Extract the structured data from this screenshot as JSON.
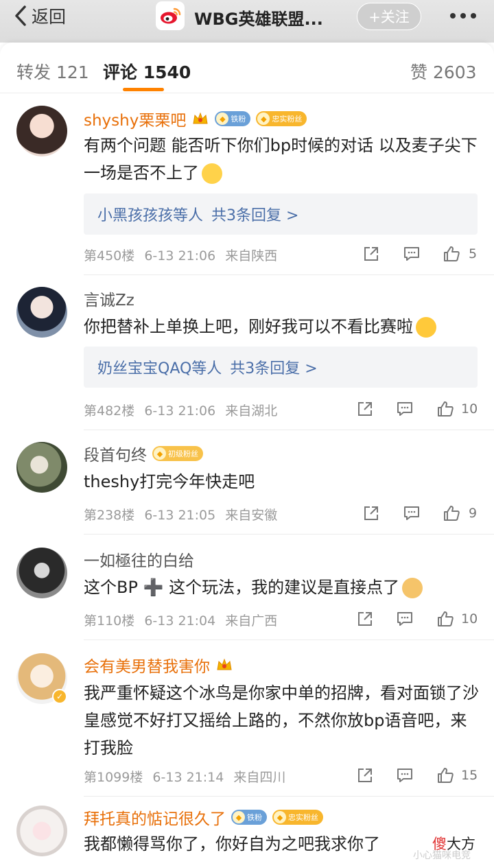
{
  "topbar": {
    "back_label": "返回",
    "title": "WBG英雄联盟...",
    "follow_label": "+关注"
  },
  "tabs": {
    "repost": "转发 121",
    "comments": "评论 1540",
    "likes": "赞 2603"
  },
  "comments": [
    {
      "user": "shyshy栗栗吧",
      "badges": [
        "铁粉",
        "忠实粉丝"
      ],
      "text": "有两个问题 能否听下你们bp时候的对话 以及麦子尖下一场是否不上了",
      "reply_users": "小黑孩孩孩等人",
      "reply_count": "共3条回复 >",
      "floor": "第450楼",
      "time": "6-13 21:06",
      "location": "来自陕西",
      "likes": "5"
    },
    {
      "user": "言诚Zz",
      "badges": [],
      "text": "你把替补上单换上吧，刚好我可以不看比赛啦",
      "reply_users": "奶丝宝宝QAQ等人",
      "reply_count": "共3条回复 >",
      "floor": "第482楼",
      "time": "6-13 21:06",
      "location": "来自湖北",
      "likes": "10"
    },
    {
      "user": "段首句终",
      "badges": [
        "初级粉丝"
      ],
      "text": "theshy打完今年快走吧",
      "floor": "第238楼",
      "time": "6-13 21:05",
      "location": "来自安徽",
      "likes": "9"
    },
    {
      "user": "一如極往的白给",
      "badges": [],
      "text": "这个BP ➕ 这个玩法，我的建议是直接点了",
      "floor": "第110楼",
      "time": "6-13 21:04",
      "location": "来自广西",
      "likes": "10"
    },
    {
      "user": "会有美男替我害你",
      "badges": [],
      "text": "我严重怀疑这个冰鸟是你家中单的招牌，看对面锁了沙皇感觉不好打又摇给上路的，不然你放bp语音吧，来打我脸",
      "floor": "第1099楼",
      "time": "6-13 21:14",
      "location": "来自四川",
      "likes": "15"
    },
    {
      "user": "拜托真的惦记很久了",
      "badges": [
        "铁粉",
        "忠实粉丝"
      ],
      "text": "我都懒得骂你了，你好自为之吧我求你了"
    }
  ],
  "watermark": {
    "main_red": "傻",
    "main": "大方",
    "sub": "小心猫咪电竞"
  },
  "colors": {
    "accent": "#ff8200",
    "vip_name": "#e8700a",
    "reply_link": "#4a6ea8"
  }
}
